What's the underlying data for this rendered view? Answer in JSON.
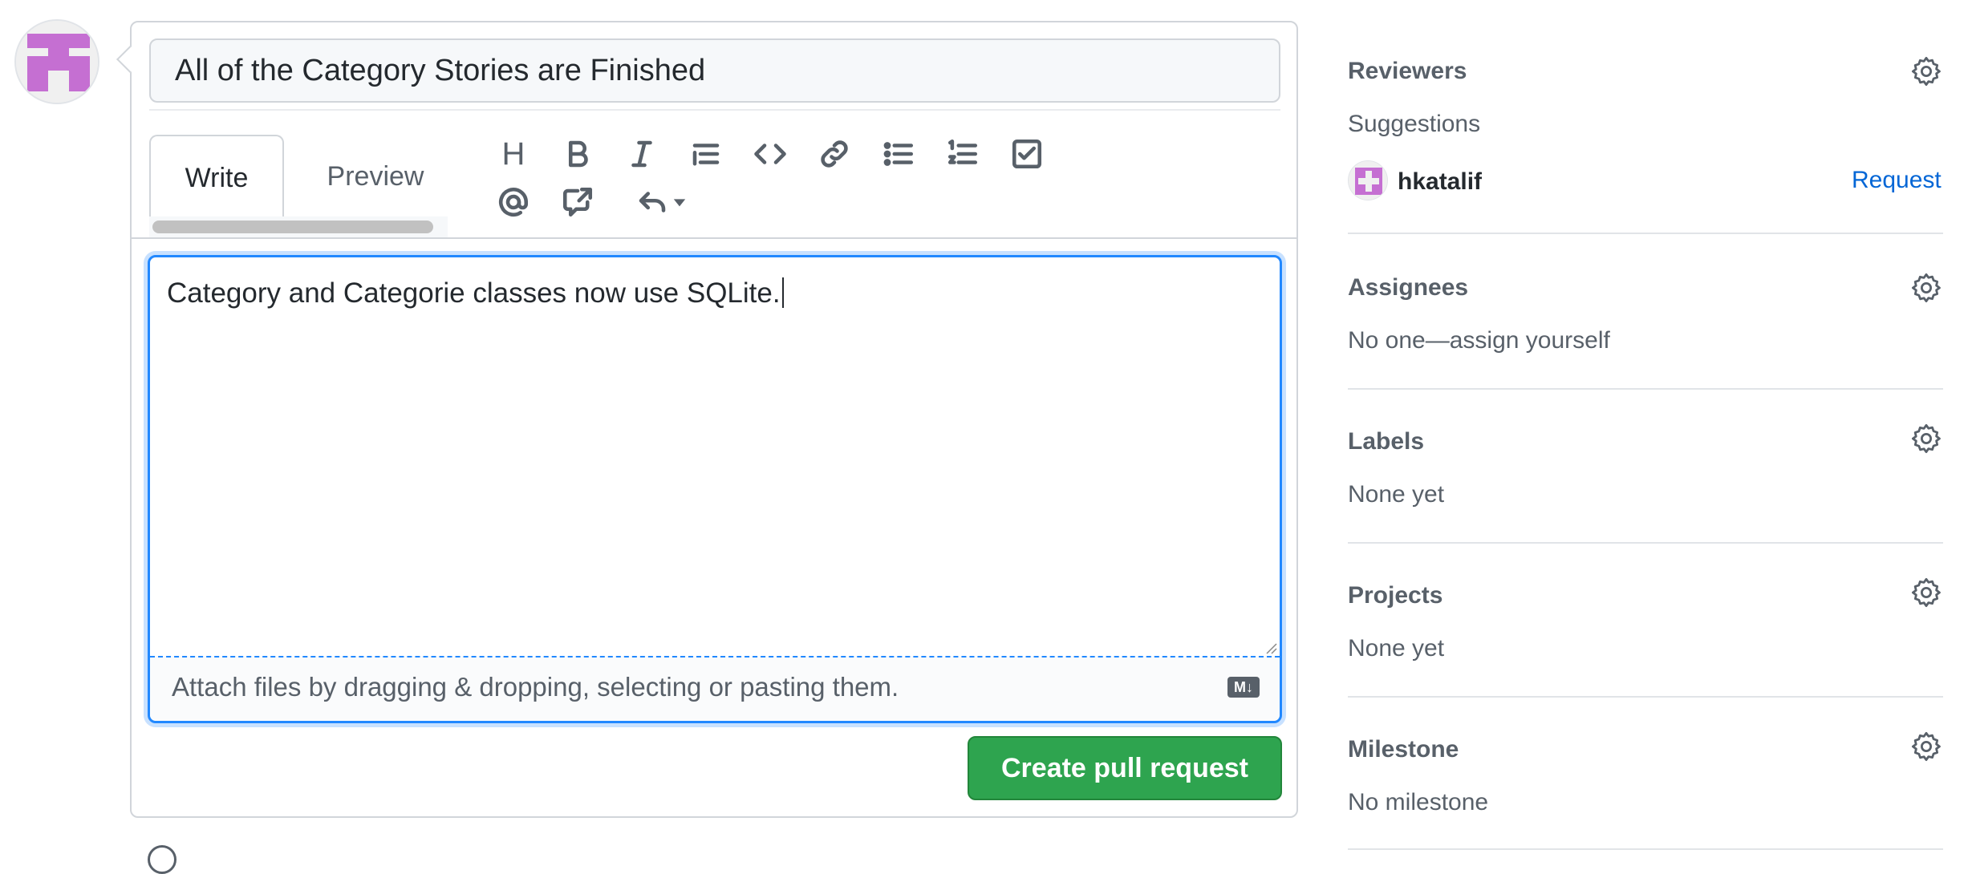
{
  "composer": {
    "title_value": "All of the Category Stories are Finished",
    "tabs": [
      {
        "label": "Write"
      },
      {
        "label": "Preview"
      }
    ],
    "toolbar_heading_glyph": "H",
    "body_value": "Category and Categorie classes now use SQLite.",
    "attach_hint": "Attach files by dragging & dropping, selecting or pasting them.",
    "markdown_badge": "M↓",
    "submit_label": "Create pull request"
  },
  "sidebar": {
    "reviewers": {
      "title": "Reviewers",
      "suggestions_label": "Suggestions",
      "suggested_user": "hkatalif",
      "request_label": "Request"
    },
    "assignees": {
      "title": "Assignees",
      "value": "No one—assign yourself"
    },
    "labels": {
      "title": "Labels",
      "value": "None yet"
    },
    "projects": {
      "title": "Projects",
      "value": "None yet"
    },
    "milestone": {
      "title": "Milestone",
      "value": "No milestone"
    }
  },
  "colors": {
    "primary_button": "#2ea44f",
    "focus_border": "#2188ff",
    "link": "#0366d6",
    "avatar_identicon": "#c56fd2"
  },
  "icons": [
    "heading-icon",
    "bold-icon",
    "italic-icon",
    "quote-icon",
    "code-icon",
    "link-icon",
    "bulleted-list-icon",
    "numbered-list-icon",
    "task-list-icon",
    "mention-icon",
    "cross-reference-icon",
    "reply-icon",
    "gear-icon",
    "markdown-icon"
  ]
}
